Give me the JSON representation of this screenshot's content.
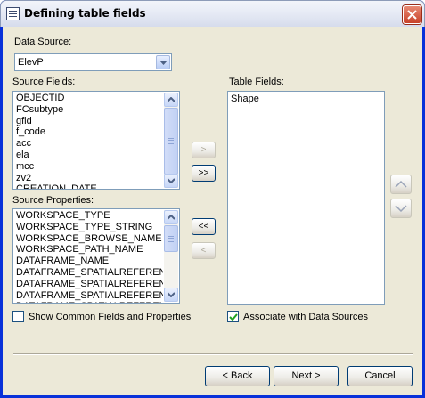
{
  "window": {
    "title": "Defining table fields"
  },
  "data_source": {
    "label": "Data Source:",
    "value": "ElevP"
  },
  "source_fields": {
    "label": "Source Fields:",
    "items": [
      "OBJECTID",
      "FCsubtype",
      "gfid",
      "f_code",
      "acc",
      "ela",
      "mcc",
      "zv2",
      "CREATION_DATE"
    ]
  },
  "table_fields": {
    "label": "Table Fields:",
    "items": [
      "Shape"
    ]
  },
  "source_properties": {
    "label": "Source Properties:",
    "items": [
      "WORKSPACE_TYPE",
      "WORKSPACE_TYPE_STRING",
      "WORKSPACE_BROWSE_NAME",
      "WORKSPACE_PATH_NAME",
      "DATAFRAME_NAME",
      "DATAFRAME_SPATIALREFERENCE",
      "DATAFRAME_SPATIALREFERENCE",
      "DATAFRAME_SPATIALREFERENCE",
      "DATAFRAME_SPATIALREFERENCE"
    ]
  },
  "move_buttons": {
    "add_one": ">",
    "add_all": ">>",
    "add_all_props": "<<",
    "add_one_prop": "<"
  },
  "checkboxes": {
    "show_common": {
      "label": "Show Common Fields and Properties",
      "checked": false
    },
    "associate": {
      "label": "Associate with Data Sources",
      "checked": true
    }
  },
  "footer": {
    "back": "< Back",
    "next": "Next >",
    "cancel": "Cancel"
  }
}
